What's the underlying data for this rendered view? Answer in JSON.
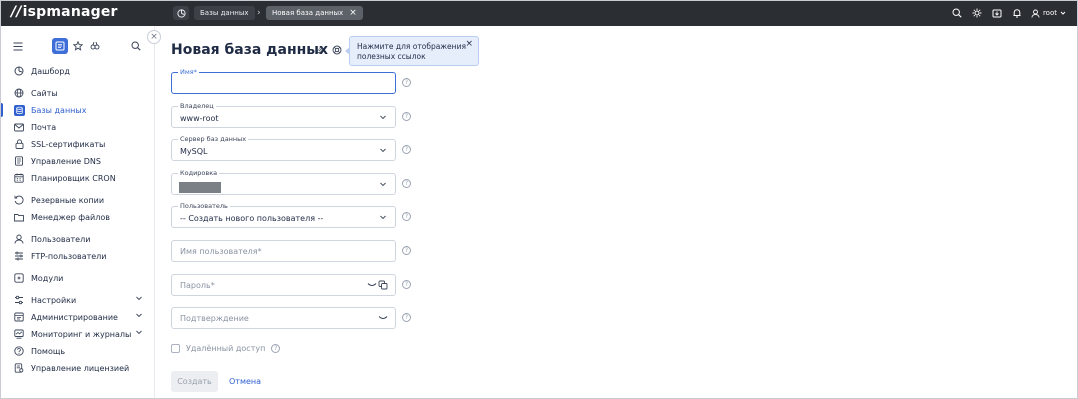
{
  "app": {
    "logo": "ispmanager"
  },
  "breadcrumb": {
    "items": [
      {
        "label": "Базы данных"
      },
      {
        "label": "Новая база данных",
        "close": "×"
      }
    ],
    "separator": "›"
  },
  "topbar": {
    "icons": [
      "search-icon",
      "theme-icon",
      "download-icon",
      "bell-icon"
    ],
    "user": "root"
  },
  "sidebar": {
    "collapse": "×",
    "items": [
      {
        "label": "Дашборд",
        "icon": "dashboard-icon"
      },
      {
        "label": "Сайты",
        "icon": "globe-icon"
      },
      {
        "label": "Базы данных",
        "icon": "database-icon",
        "active": true
      },
      {
        "label": "Почта",
        "icon": "mail-icon"
      },
      {
        "label": "SSL-сертификаты",
        "icon": "lock-icon"
      },
      {
        "label": "Управление DNS",
        "icon": "dns-icon"
      },
      {
        "label": "Планировщик CRON",
        "icon": "calendar-icon"
      },
      {
        "label": "Резервные копии",
        "icon": "backup-icon"
      },
      {
        "label": "Менеджер файлов",
        "icon": "folder-icon"
      },
      {
        "label": "Пользователи",
        "icon": "user-icon"
      },
      {
        "label": "FTP-пользователи",
        "icon": "ftp-icon"
      },
      {
        "label": "Модули",
        "icon": "modules-icon"
      },
      {
        "label": "Настройки",
        "icon": "settings-icon",
        "expandable": true
      },
      {
        "label": "Администрирование",
        "icon": "admin-icon",
        "expandable": true
      },
      {
        "label": "Мониторинг и журналы",
        "icon": "monitoring-icon",
        "expandable": true
      },
      {
        "label": "Помощь",
        "icon": "help-icon"
      },
      {
        "label": "Управление лицензией",
        "icon": "license-icon"
      }
    ]
  },
  "page": {
    "title": "Новая база данных",
    "tooltip": "Нажмите для отображения полезных ссылок",
    "tooltip_close": "×"
  },
  "form": {
    "name": {
      "label": "Имя*",
      "value": ""
    },
    "owner": {
      "label": "Владелец",
      "value": "www-root"
    },
    "server": {
      "label": "Сервер баз данных",
      "value": "MySQL"
    },
    "encoding": {
      "label": "Кодировка",
      "value": ""
    },
    "user": {
      "label": "Пользователь",
      "value": "-- Создать нового пользователя --"
    },
    "username": {
      "placeholder": "Имя пользователя*"
    },
    "password": {
      "placeholder": "Пароль*"
    },
    "confirm": {
      "placeholder": "Подтверждение"
    },
    "remote_access": {
      "label": "Удалённый доступ",
      "checked": false
    },
    "help_glyph": "?"
  },
  "actions": {
    "create": "Создать",
    "cancel": "Отмена"
  }
}
